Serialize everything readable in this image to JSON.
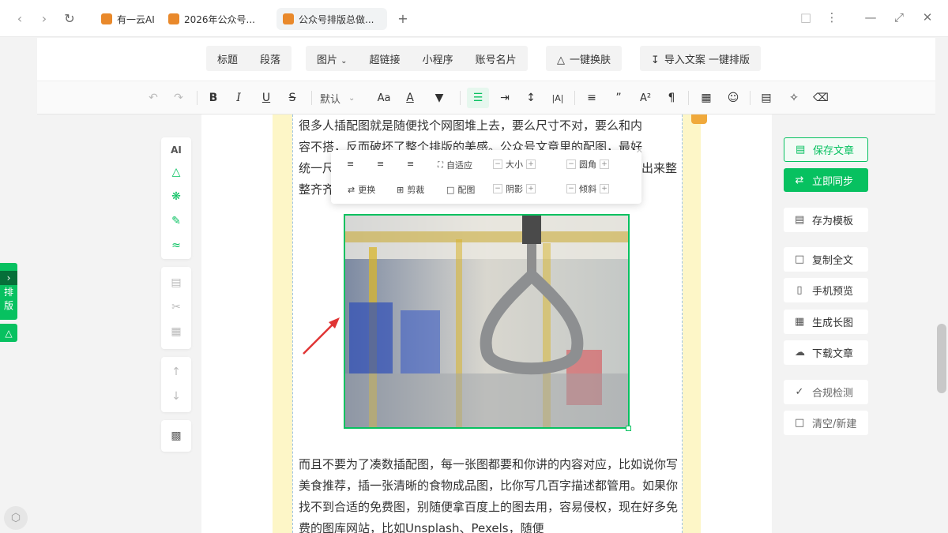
{
  "browser": {
    "tabs": [
      {
        "title": "有一云AI",
        "active": false
      },
      {
        "title": "2026年公众号...",
        "active": false
      },
      {
        "title": "公众号排版总做...",
        "active": true
      }
    ],
    "new_tab": "+"
  },
  "menubar": {
    "group1": [
      "标题",
      "段落"
    ],
    "group2": [
      "图片",
      "超链接",
      "小程序",
      "账号名片"
    ],
    "skin": "一键换肤",
    "import": "导入文案 一键排版"
  },
  "toolbar": {
    "font_default": "默认"
  },
  "left_tab": {
    "label1": "排",
    "label2": "版"
  },
  "left_panel": {
    "ai": "AI"
  },
  "image_toolbar": {
    "adaptive": "自适应",
    "size": "大小",
    "radius": "圆角",
    "replace": "更换",
    "crop": "剪裁",
    "caption": "配图",
    "shadow": "阴影",
    "tilt": "倾斜"
  },
  "article": {
    "para1_lines": [
      "很多人插配图就是随便找个网图堆上去，要么尺寸不对，要么和内",
      "容不搭，反而破坏了整个排版的美感。公众号文章里的配图，最好",
      "统一尺",
      "整齐齐"
    ],
    "para1_tail": "出来整",
    "para2": "而且不要为了凑数插配图，每一张图都要和你讲的内容对应，比如说你写美食推荐，插一张清晰的食物成品图，比你写几百字描述都管用。如果你找不到合适的免费图，别随便拿百度上的图去用，容易侵权，现在好多免费的图库网站，比如Unsplash、Pexels，随便"
  },
  "right_panel": {
    "save": "保存文章",
    "sync": "立即同步",
    "template": "存为模板",
    "copy": "复制全文",
    "preview": "手机预览",
    "longimg": "生成长图",
    "download": "下载文章",
    "check": "合规检测",
    "clear": "清空/新建"
  },
  "colors": {
    "accent": "#07c160",
    "frame": "#fdf6c7",
    "arrow": "#e03434"
  }
}
